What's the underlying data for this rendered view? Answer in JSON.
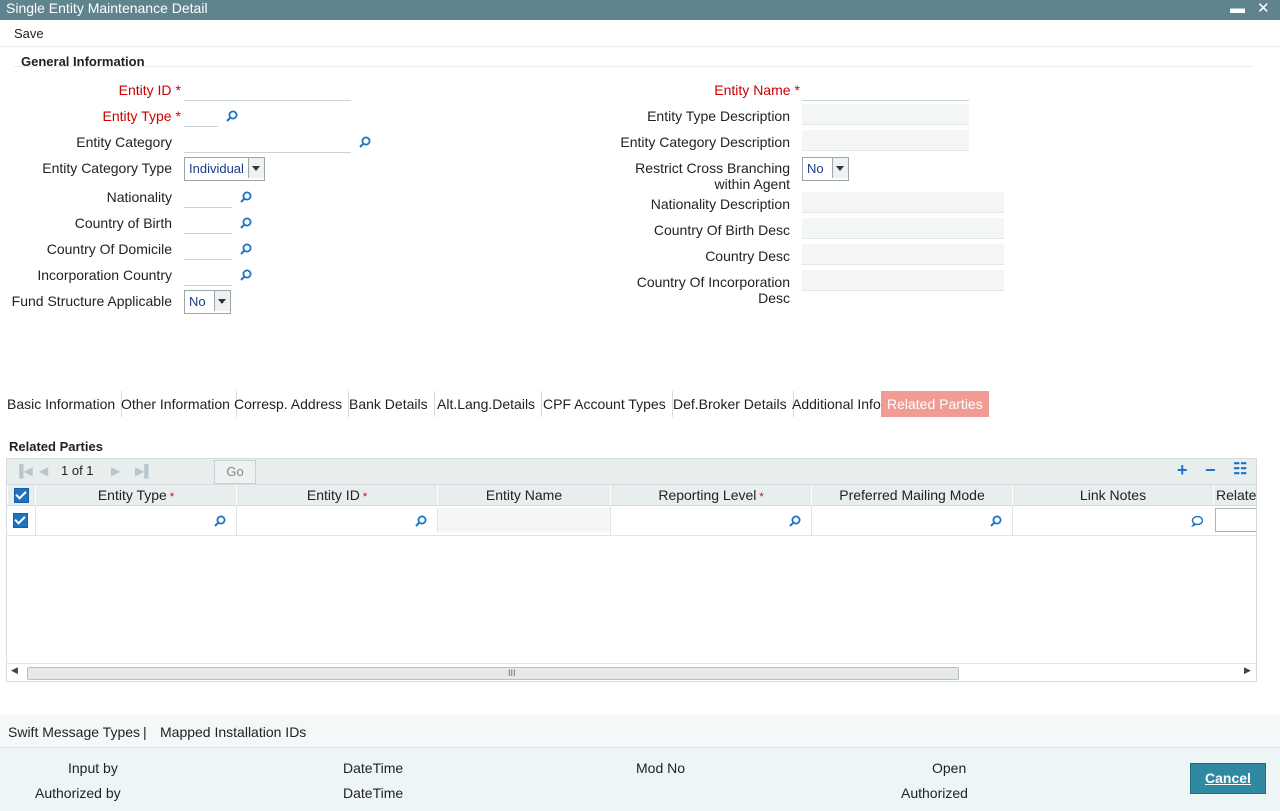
{
  "window": {
    "title": "Single Entity Maintenance Detail",
    "minimize_glyph": "▬",
    "close_glyph": "✕"
  },
  "menu": {
    "save_label": "Save"
  },
  "general": {
    "section_title": "General Information",
    "left_fields": {
      "entity_id": "Entity ID",
      "entity_type": "Entity Type",
      "entity_category": "Entity Category",
      "entity_category_type": "Entity Category Type",
      "nationality": "Nationality",
      "country_of_birth": "Country of Birth",
      "country_of_domicile": "Country Of Domicile",
      "incorporation_country": "Incorporation Country",
      "fund_structure_applicable": "Fund Structure Applicable"
    },
    "right_fields": {
      "entity_name": "Entity Name",
      "entity_type_description": "Entity Type Description",
      "entity_category_description": "Entity Category Description",
      "restrict_cross_branching_1": "Restrict Cross Branching",
      "restrict_cross_branching_2": "within Agent",
      "nationality_description": "Nationality Description",
      "country_of_birth_desc": "Country Of Birth Desc",
      "country_desc": "Country Desc",
      "country_of_incorporation_desc_1": "Country Of Incorporation",
      "country_of_incorporation_desc_2": "Desc"
    },
    "required_marker": "*",
    "values": {
      "entity_category_type": "Individual",
      "fund_structure_applicable": "No",
      "restrict_cross_branching": "No"
    }
  },
  "tabs": [
    "Basic Information",
    "Other Information",
    "Corresp. Address",
    "Bank Details",
    "Alt.Lang.Details",
    "CPF Account Types",
    "Def.Broker Details",
    "Additional Info",
    "Related Parties"
  ],
  "related_parties": {
    "title": "Related Parties",
    "pager": {
      "text": "1 of 1",
      "go_label": "Go"
    },
    "toolbar": {
      "add": "+",
      "remove": "−",
      "view": "☷"
    },
    "columns": [
      "Entity Type",
      "Entity ID",
      "Entity Name",
      "Reporting Level",
      "Preferred Mailing Mode",
      "Link Notes",
      "Relatec"
    ],
    "required_marker": "*",
    "scroll_grip": "III"
  },
  "links": {
    "swift": "Swift Message Types",
    "separator": "|",
    "mapped": "Mapped Installation IDs"
  },
  "footer": {
    "input_by": "Input by",
    "datetime1": "DateTime",
    "mod_no": "Mod No",
    "open": "Open",
    "authorized_by": "Authorized by",
    "datetime2": "DateTime",
    "authorized": "Authorized",
    "cancel_label": "Cancel"
  },
  "colors": {
    "titlebar": "#5f848e",
    "accent": "#1a75c7",
    "active_tab": "#f29b94",
    "required": "#cc0000",
    "cancel": "#2f8aa1"
  }
}
